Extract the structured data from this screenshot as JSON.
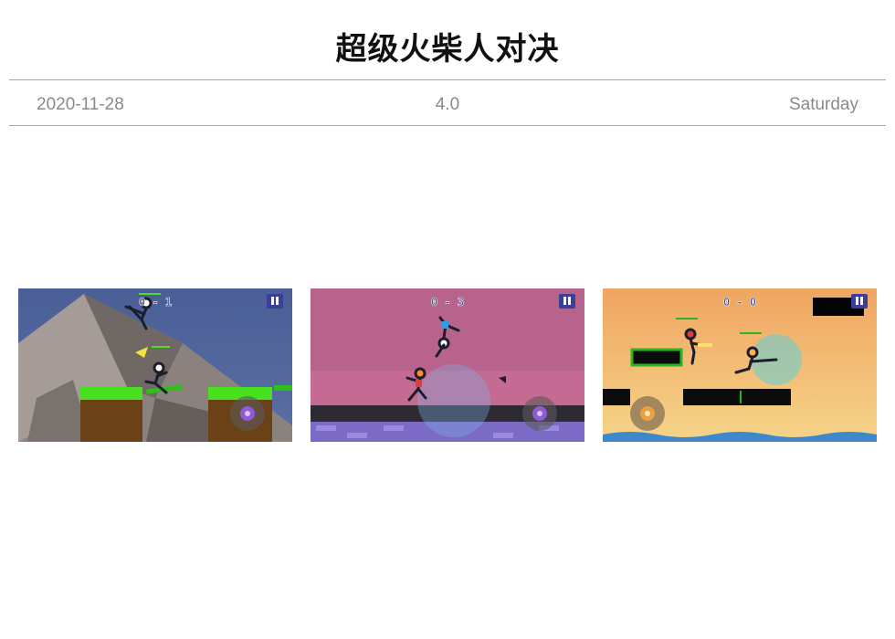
{
  "app": {
    "title": "超级火柴人对决"
  },
  "meta": {
    "date": "2020-11-28",
    "rating": "4.0",
    "weekday": "Saturday"
  },
  "screenshots": [
    {
      "score": "0 - 1",
      "icons": [
        "pause-icon",
        "joystick-icon"
      ]
    },
    {
      "score": "0 - 3",
      "icons": [
        "pause-icon",
        "joystick-icon"
      ]
    },
    {
      "score": "0 - 0",
      "icons": [
        "pause-icon",
        "joystick-icon"
      ]
    }
  ],
  "colors": {
    "title": "#111111",
    "meta_text": "#8a8a8a",
    "divider": "#a8a8a8"
  }
}
